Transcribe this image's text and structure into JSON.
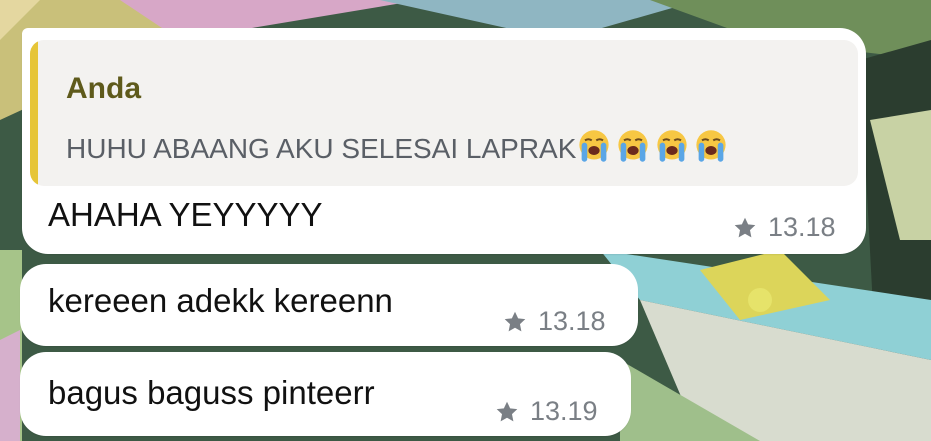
{
  "quoted_reply": {
    "sender": "Anda",
    "text": "HUHU ABAANG AKU SELESAI LAPRAK",
    "emoji": [
      "loudly-crying-face",
      "loudly-crying-face",
      "loudly-crying-face",
      "loudly-crying-face"
    ]
  },
  "messages": [
    {
      "text": "AHAHA YEYYYYY",
      "time": "13.18",
      "icon": "star-icon"
    },
    {
      "text": "kereeen adekk kereenn",
      "time": "13.18",
      "icon": "star-icon"
    },
    {
      "text": "bagus baguss pinteerr",
      "time": "13.19",
      "icon": "star-icon"
    }
  ],
  "colors": {
    "bubble": "#ffffff",
    "quote_bar": "#e6c538",
    "quote_sender": "#5e5a1b",
    "meta": "#7a7f85"
  }
}
